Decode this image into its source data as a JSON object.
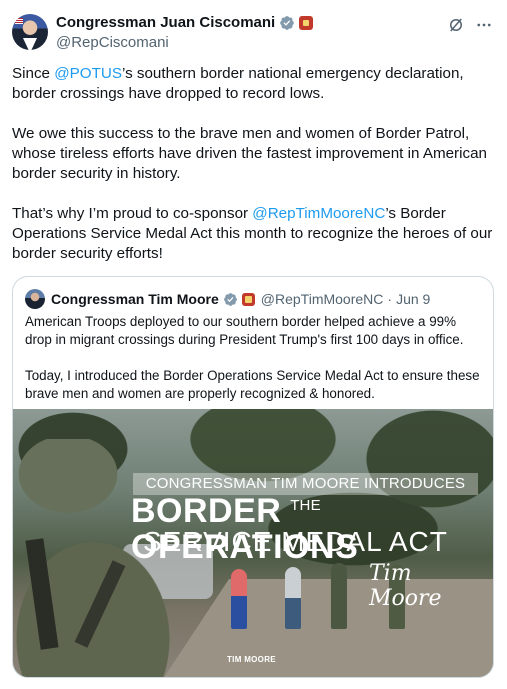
{
  "author": {
    "display_name": "Congressman Juan Ciscomani",
    "handle": "@RepCiscomani",
    "avatar_icon": "profile-photo",
    "verified_icon": "verified-badge-icon"
  },
  "actions": {
    "grok_icon": "grok-icon",
    "more_icon": "more-icon"
  },
  "tweet": {
    "p1_prefix": "Since ",
    "p1_mention": "@POTUS",
    "p1_suffix": "’s southern border national emergency declaration, border crossings have dropped to record lows.",
    "p2": "We owe this success to the brave men and women of Border Patrol, whose tireless efforts have driven the fastest improvement in American border security in history.",
    "p3_prefix": "That’s why I’m proud to co-sponsor ",
    "p3_mention": "@RepTimMooreNC",
    "p3_suffix": "’s Border Operations Service Medal Act this month to recognize the heroes of our border security efforts!"
  },
  "quote": {
    "display_name": "Congressman Tim Moore",
    "handle": "@RepTimMooreNC",
    "separator": "·",
    "date": "Jun 9",
    "p1": "American Troops deployed to our southern border helped achieve a 99% drop in migrant crossings during President Trump's first 100 days in office.",
    "p2": "Today, I introduced the Border Operations Service Medal Act to ensure these brave men and women are properly recognized & honored."
  },
  "media": {
    "banner_top": "CONGRESSMAN TIM MOORE INTRODUCES THE",
    "banner_main": "BORDER OPERATIONS",
    "banner_sub": "SERVICE MEDAL ACT",
    "signature": "Tim Moore",
    "watermark": "TIM MOORE"
  },
  "colors": {
    "link": "#1d9bf0",
    "text": "#0f1419",
    "secondary": "#536471",
    "verified": "#829aab"
  }
}
